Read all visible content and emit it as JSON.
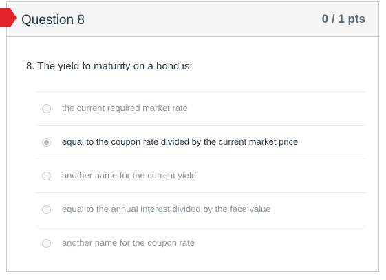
{
  "question": {
    "title": "Question 8",
    "points": "0 / 1 pts",
    "text": "8. The yield to maturity on a bond is:",
    "flag_color": "#e0242a"
  },
  "answers": [
    {
      "label": "the current required market rate",
      "selected": false
    },
    {
      "label": "equal to the coupon rate divided by the current market price",
      "selected": true
    },
    {
      "label": "another name for the current yield",
      "selected": false
    },
    {
      "label": "equal to the annual interest divided by the face value",
      "selected": false
    },
    {
      "label": "another name for the coupon rate",
      "selected": false
    }
  ]
}
